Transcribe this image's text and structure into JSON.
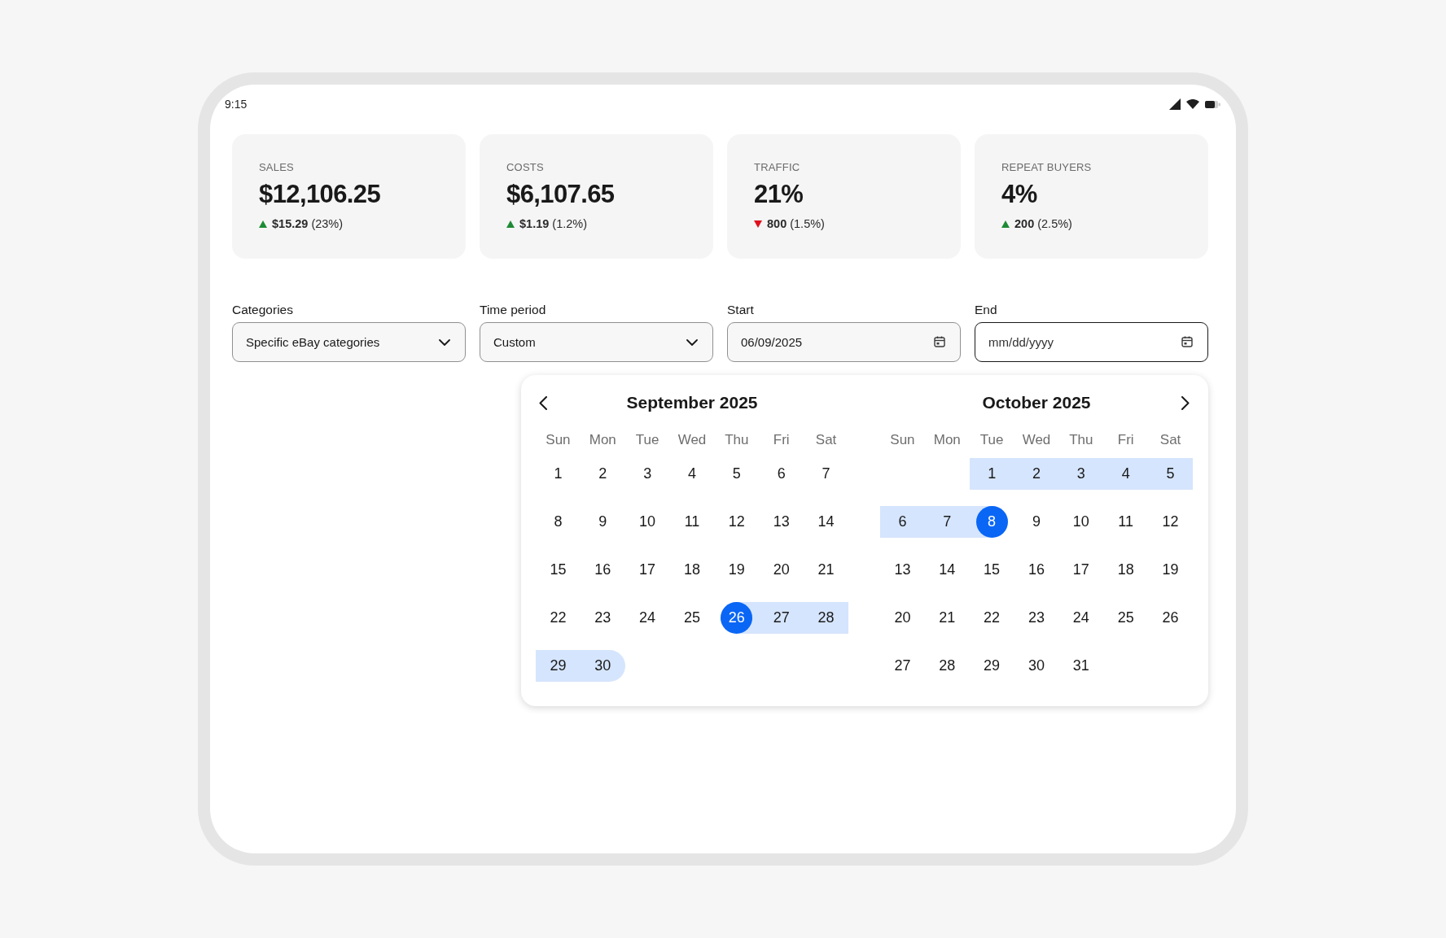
{
  "status_bar": {
    "time": "9:15"
  },
  "metrics": [
    {
      "label": "SALES",
      "value": "$12,106.25",
      "kind": "up",
      "change": "**$15.29** (23%)"
    },
    {
      "label": "COSTS",
      "value": "$6,107.65",
      "kind": "up",
      "change": "**$1.19** (1.2%)"
    },
    {
      "label": "TRAFFIC",
      "value": "21%",
      "kind": "down",
      "change": "**800** (1.5%)"
    },
    {
      "label": "REPEAT BUYERS",
      "value": "4%",
      "kind": "up",
      "change": "**200** (2.5%)"
    }
  ],
  "filters": [
    {
      "label": "Categories",
      "kind": "select",
      "value": "Specific eBay categories",
      "focused": false
    },
    {
      "label": "Time period",
      "kind": "select",
      "value": "Custom",
      "focused": false
    },
    {
      "label": "Start",
      "kind": "date",
      "value": "06/09/2025",
      "focused": false
    },
    {
      "label": "End",
      "kind": "date",
      "placeholder": "mm/dd/yyyy",
      "focused": true
    }
  ],
  "date_picker": {
    "months": [
      {
        "title": "September 2025",
        "weekdays": [
          "Sun",
          "Mon",
          "Tue",
          "Wed",
          "Thu",
          "Fri",
          "Sat"
        ],
        "weeks": [
          {
            "days": [
              {
                "label": "1",
                "selected": false,
                "in_range": false
              },
              {
                "label": "2",
                "selected": false,
                "in_range": false
              },
              {
                "label": "3",
                "selected": false,
                "in_range": false
              },
              {
                "label": "4",
                "selected": false,
                "in_range": false
              },
              {
                "label": "5",
                "selected": false,
                "in_range": false
              },
              {
                "label": "6",
                "selected": false,
                "in_range": false
              },
              {
                "label": "7",
                "selected": false,
                "in_range": false
              }
            ]
          },
          {
            "days": [
              {
                "label": "8",
                "selected": false,
                "in_range": false
              },
              {
                "label": "9",
                "selected": false,
                "in_range": false
              },
              {
                "label": "10",
                "selected": false,
                "in_range": false
              },
              {
                "label": "11",
                "selected": false,
                "in_range": false
              },
              {
                "label": "12",
                "selected": false,
                "in_range": false
              },
              {
                "label": "13",
                "selected": false,
                "in_range": false
              },
              {
                "label": "14",
                "selected": false,
                "in_range": false
              }
            ]
          },
          {
            "days": [
              {
                "label": "15",
                "selected": false,
                "in_range": false
              },
              {
                "label": "16",
                "selected": false,
                "in_range": false
              },
              {
                "label": "17",
                "selected": false,
                "in_range": false
              },
              {
                "label": "18",
                "selected": false,
                "in_range": false
              },
              {
                "label": "19",
                "selected": false,
                "in_range": false
              },
              {
                "label": "20",
                "selected": false,
                "in_range": false
              },
              {
                "label": "21",
                "selected": false,
                "in_range": false
              }
            ]
          },
          {
            "days": [
              {
                "label": "22",
                "selected": false,
                "in_range": false
              },
              {
                "label": "23",
                "selected": false,
                "in_range": false
              },
              {
                "label": "24",
                "selected": false,
                "in_range": false
              },
              {
                "label": "25",
                "selected": false,
                "in_range": false
              },
              {
                "label": "26",
                "selected": true,
                "in_range": false
              },
              {
                "label": "27",
                "selected": false,
                "in_range": true
              },
              {
                "label": "28",
                "selected": false,
                "in_range": true
              }
            ]
          },
          {
            "days": [
              {
                "label": "29",
                "selected": false,
                "in_range": true
              },
              {
                "label": "30",
                "selected": false,
                "in_range": true
              }
            ]
          }
        ]
      },
      {
        "title": "October 2025",
        "weekdays": [
          "Sun",
          "Mon",
          "Tue",
          "Wed",
          "Thu",
          "Fri",
          "Sat"
        ],
        "weeks": [
          {
            "days": [
              {
                "label": "1",
                "selected": false,
                "in_range": true
              },
              {
                "label": "2",
                "selected": false,
                "in_range": true
              },
              {
                "label": "3",
                "selected": false,
                "in_range": true
              },
              {
                "label": "4",
                "selected": false,
                "in_range": true
              },
              {
                "label": "5",
                "selected": false,
                "in_range": true
              }
            ]
          },
          {
            "days": [
              {
                "label": "6",
                "selected": false,
                "in_range": true
              },
              {
                "label": "7",
                "selected": false,
                "in_range": true
              },
              {
                "label": "8",
                "selected": true,
                "in_range": false
              },
              {
                "label": "9",
                "selected": false,
                "in_range": false
              },
              {
                "label": "10",
                "selected": false,
                "in_range": false
              },
              {
                "label": "11",
                "selected": false,
                "in_range": false
              },
              {
                "label": "12",
                "selected": false,
                "in_range": false
              }
            ]
          },
          {
            "days": [
              {
                "label": "13",
                "selected": false,
                "in_range": false
              },
              {
                "label": "14",
                "selected": false,
                "in_range": false
              },
              {
                "label": "15",
                "selected": false,
                "in_range": false
              },
              {
                "label": "16",
                "selected": false,
                "in_range": false
              },
              {
                "label": "17",
                "selected": false,
                "in_range": false
              },
              {
                "label": "18",
                "selected": false,
                "in_range": false
              },
              {
                "label": "19",
                "selected": false,
                "in_range": false
              }
            ]
          },
          {
            "days": [
              {
                "label": "20",
                "selected": false,
                "in_range": false
              },
              {
                "label": "21",
                "selected": false,
                "in_range": false
              },
              {
                "label": "22",
                "selected": false,
                "in_range": false
              },
              {
                "label": "23",
                "selected": false,
                "in_range": false
              },
              {
                "label": "24",
                "selected": false,
                "in_range": false
              },
              {
                "label": "25",
                "selected": false,
                "in_range": false
              },
              {
                "label": "26",
                "selected": false,
                "in_range": false
              }
            ]
          },
          {
            "days": [
              {
                "label": "27",
                "selected": false,
                "in_range": false
              },
              {
                "label": "28",
                "selected": false,
                "in_range": false
              },
              {
                "label": "29",
                "selected": false,
                "in_range": false
              },
              {
                "label": "30",
                "selected": false,
                "in_range": false
              },
              {
                "label": "31",
                "selected": false,
                "in_range": false
              }
            ]
          }
        ]
      }
    ]
  }
}
